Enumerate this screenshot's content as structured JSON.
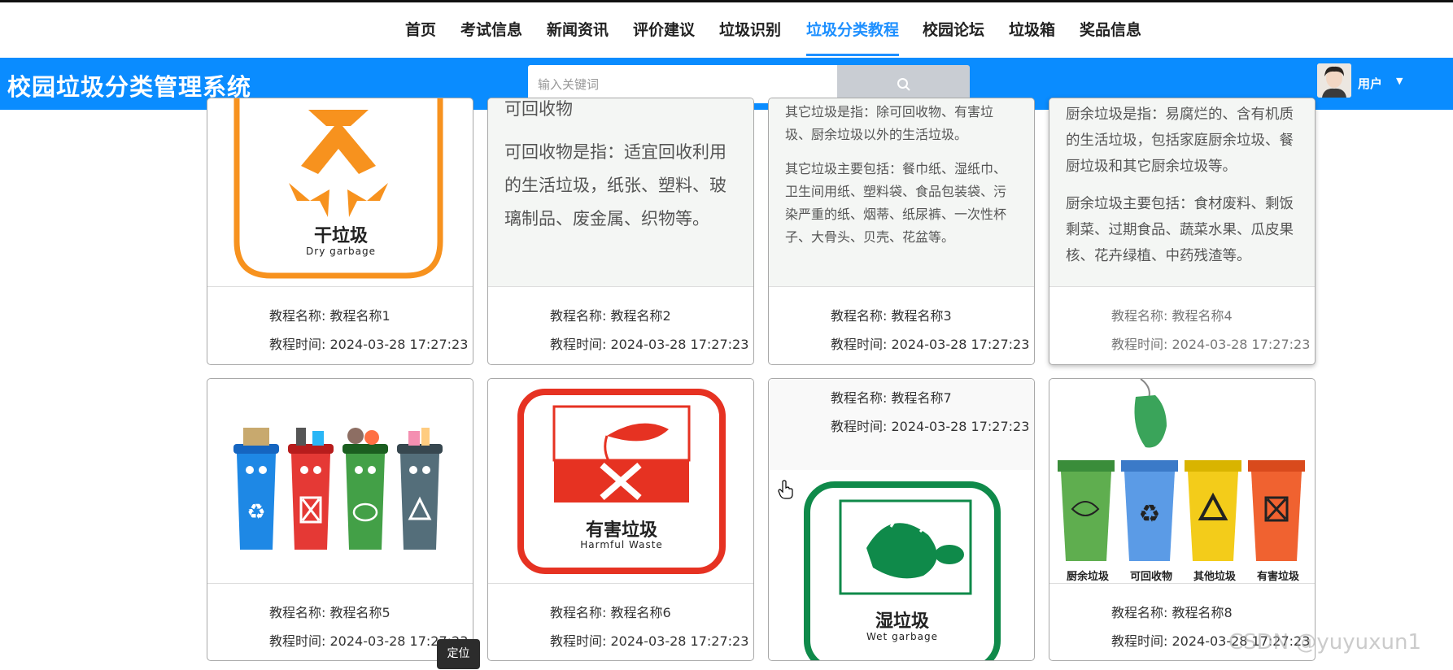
{
  "nav": {
    "items": [
      {
        "label": "首页"
      },
      {
        "label": "考试信息"
      },
      {
        "label": "新闻资讯"
      },
      {
        "label": "评价建议"
      },
      {
        "label": "垃圾识别"
      },
      {
        "label": "垃圾分类教程"
      },
      {
        "label": "校园论坛"
      },
      {
        "label": "垃圾箱"
      },
      {
        "label": "奖品信息"
      }
    ],
    "active_index": 5
  },
  "header": {
    "brand": "校园垃圾分类管理系统",
    "search_placeholder": "输入关键词",
    "user_label": "用户",
    "accent_color": "#0a8cff"
  },
  "cards": [
    {
      "name_label": "教程名称: 教程名称1",
      "time_label": "教程时间: 2024-03-28 17:27:23",
      "image_title": "干垃圾",
      "image_subtitle": "Dry garbage"
    },
    {
      "name_label": "教程名称: 教程名称2",
      "time_label": "教程时间: 2024-03-28 17:27:23",
      "text_heading": "可回收物",
      "text_body": "可回收物是指：适宜回收利用的生活垃圾，纸张、塑料、玻璃制品、废金属、织物等。"
    },
    {
      "name_label": "教程名称: 教程名称3",
      "time_label": "教程时间: 2024-03-28 17:27:23",
      "text_p1": "其它垃圾是指：除可回收物、有害垃圾、厨余垃圾以外的生活垃圾。",
      "text_p2": "其它垃圾主要包括：餐巾纸、湿纸巾、卫生间用纸、塑料袋、食品包装袋、污染严重的纸、烟蒂、纸尿裤、一次性杯子、大骨头、贝壳、花盆等。"
    },
    {
      "name_label": "教程名称: 教程名称4",
      "time_label": "教程时间: 2024-03-28 17:27:23",
      "text_p1": "厨余垃圾是指：易腐烂的、含有机质的生活垃圾，包括家庭厨余垃圾、餐厨垃圾和其它厨余垃圾等。",
      "text_p2": "厨余垃圾主要包括：食材废料、剩饭剩菜、过期食品、蔬菜水果、瓜皮果核、花卉绿植、中药残渣等。"
    },
    {
      "name_label": "教程名称: 教程名称5",
      "time_label": "教程时间: 2024-03-28 17:27:23"
    },
    {
      "name_label": "教程名称: 教程名称6",
      "time_label": "教程时间: 2024-03-28 17:27:23",
      "image_title": "有害垃圾",
      "image_subtitle": "Harmful Waste"
    },
    {
      "name_label": "教程名称: 教程名称7",
      "time_label": "教程时间: 2024-03-28 17:27:23",
      "image_title": "湿垃圾",
      "image_subtitle": "Wet garbage"
    },
    {
      "name_label": "教程名称: 教程名称8",
      "time_label": "教程时间: 2024-03-28 17:27:23",
      "bin_labels": [
        "厨余垃圾",
        "可回收物",
        "其他垃圾",
        "有害垃圾"
      ]
    }
  ],
  "tooltip": "定位",
  "watermark": "CSDN @yuyuxun1"
}
